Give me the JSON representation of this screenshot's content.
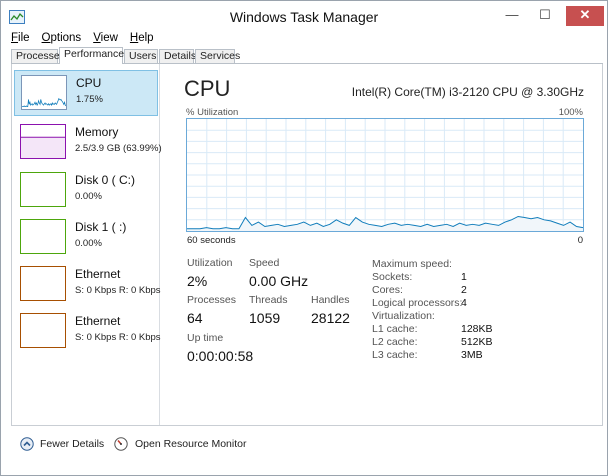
{
  "window": {
    "title": "Windows Task Manager",
    "min_glyph": "—",
    "max_glyph": "☐",
    "close_glyph": "✕"
  },
  "menu": {
    "items": [
      {
        "underline": "F",
        "rest": "ile"
      },
      {
        "underline": "O",
        "rest": "ptions"
      },
      {
        "underline": "V",
        "rest": "iew"
      },
      {
        "underline": "H",
        "rest": "elp"
      }
    ]
  },
  "tabs": [
    "Processes",
    "Performance",
    "Users",
    "Details",
    "Services"
  ],
  "sidebar": {
    "items": [
      {
        "title": "CPU",
        "sub": "1.75%",
        "color": "#117dbb"
      },
      {
        "title": "Memory",
        "sub": "2.5/3.9 GB (63.99%)",
        "color": "#8b12ae"
      },
      {
        "title": "Disk 0 ( C:)",
        "sub": "0.00%",
        "color": "#4da60c"
      },
      {
        "title": "Disk 1 ( :)",
        "sub": "0.00%",
        "color": "#4da60c"
      },
      {
        "title": "Ethernet",
        "sub": "S: 0 Kbps R: 0 Kbps",
        "color": "#a74f01"
      },
      {
        "title": "Ethernet",
        "sub": "S: 0 Kbps R: 0 Kbps",
        "color": "#a74f01"
      }
    ]
  },
  "main": {
    "title": "CPU",
    "model": "Intel(R) Core(TM) i3-2120 CPU @ 3.30GHz",
    "y_label": "% Utilization",
    "y_max_label": "100%",
    "x_left_label": "60 seconds",
    "x_right_label": "0",
    "graph_color": "#117dbb",
    "graph_fill": "#f1f6fa",
    "grid_color": "#d9eaf7",
    "utilization_history": [
      2,
      2,
      2,
      3,
      2,
      2,
      3,
      2,
      2,
      12,
      5,
      8,
      4,
      5,
      6,
      4,
      5,
      6,
      8,
      5,
      7,
      4,
      6,
      10,
      7,
      5,
      12,
      8,
      6,
      5,
      4,
      6,
      7,
      5,
      6,
      5,
      4,
      6,
      4,
      5,
      6,
      4,
      7,
      5,
      6,
      5,
      7,
      6,
      5,
      8,
      10,
      13,
      12,
      11,
      12,
      10,
      9,
      7,
      5,
      8,
      4,
      3
    ],
    "stats": {
      "utilization_label": "Utilization",
      "utilization_value": "2%",
      "speed_label": "Speed",
      "speed_value": "0.00 GHz",
      "processes_label": "Processes",
      "processes_value": "64",
      "threads_label": "Threads",
      "threads_value": "1059",
      "handles_label": "Handles",
      "handles_value": "28122",
      "uptime_label": "Up time",
      "uptime_value": "0:00:00:58"
    },
    "specs": [
      {
        "label": "Maximum speed:",
        "value": ""
      },
      {
        "label": "Sockets:",
        "value": "1"
      },
      {
        "label": "Cores:",
        "value": "2"
      },
      {
        "label": "Logical processors:",
        "value": "4"
      },
      {
        "label": "Virtualization:",
        "value": ""
      },
      {
        "label": "L1 cache:",
        "value": "128KB"
      },
      {
        "label": "L2 cache:",
        "value": "512KB"
      },
      {
        "label": "L3 cache:",
        "value": "3MB"
      }
    ]
  },
  "footer": {
    "fewer_details": "Fewer Details",
    "resource_monitor": "Open Resource Monitor"
  }
}
